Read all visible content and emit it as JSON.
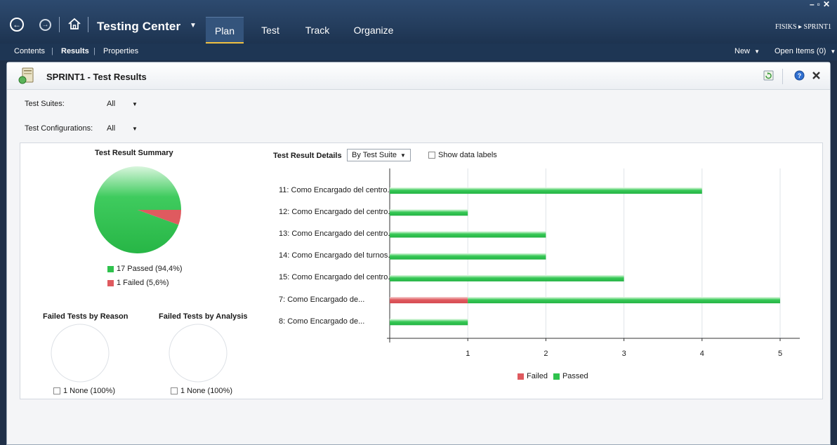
{
  "window": {
    "app_title": "Testing Center",
    "project_crumb": "FISIKS ▸ SPRINT1",
    "controls": [
      "–",
      "▫",
      "✕"
    ]
  },
  "nav": {
    "tabs": [
      {
        "label": "Plan",
        "active": true
      },
      {
        "label": "Test",
        "active": false
      },
      {
        "label": "Track",
        "active": false
      },
      {
        "label": "Organize",
        "active": false
      }
    ]
  },
  "subnav": {
    "items": [
      "Contents",
      "Results",
      "Properties"
    ],
    "new_label": "New",
    "open_items_label": "Open Items (0)"
  },
  "panel": {
    "title": "SPRINT1 - Test Results"
  },
  "filters": {
    "suites_label": "Test Suites:",
    "suites_value": "All",
    "configs_label": "Test Configurations:",
    "configs_value": "All"
  },
  "summary": {
    "title": "Test Result Summary",
    "passed_label": "17 Passed (94,4%)",
    "failed_label": "1 Failed (5,6%)",
    "passed": 17,
    "failed": 1
  },
  "reason": {
    "title": "Failed Tests by Reason",
    "legend": "1 None (100%)"
  },
  "analysis": {
    "title": "Failed Tests by Analysis",
    "legend": "1 None (100%)"
  },
  "details": {
    "title": "Test Result Details",
    "group_by": "By Test Suite",
    "show_labels": "Show data labels"
  },
  "colors": {
    "passed": "#2fc24d",
    "failed": "#df5a5f"
  },
  "chart_data": {
    "type": "bar",
    "orientation": "horizontal",
    "stacked": true,
    "categories": [
      "11: Como Encargado del centro...",
      "12: Como Encargado del centro...",
      "13: Como Encargado del centro...",
      "14: Como Encargado del turnos...",
      "15: Como Encargado del centro...",
      "7: Como Encargado de...",
      "8: Como Encargado de..."
    ],
    "series": [
      {
        "name": "Failed",
        "values": [
          0,
          0,
          0,
          0,
          0,
          1,
          0
        ]
      },
      {
        "name": "Passed",
        "values": [
          4,
          1,
          2,
          2,
          3,
          4,
          1
        ]
      }
    ],
    "xlim": [
      0,
      5
    ],
    "xticks": [
      "1",
      "2",
      "3",
      "4",
      "5"
    ],
    "grid": true,
    "legend": "bottom"
  }
}
